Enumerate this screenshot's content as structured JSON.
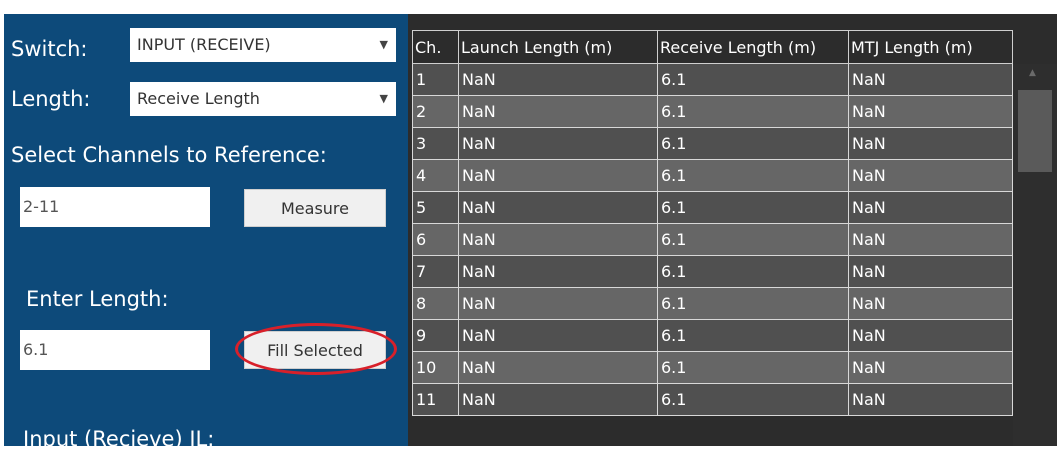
{
  "controls": {
    "switch_label": "Switch:",
    "switch_value": "INPUT (RECEIVE)",
    "length_label": "Length:",
    "length_value": "Receive Length",
    "select_channels_label": "Select Channels to Reference:",
    "channels_value": "2-11",
    "measure_button": "Measure",
    "enter_length_label": "Enter Length:",
    "length_input_value": "6.1",
    "fill_selected_button": "Fill Selected",
    "input_il_label": "Input (Recieve) IL:"
  },
  "table": {
    "columns": [
      "Ch.",
      "Launch Length (m)",
      "Receive Length (m)",
      "MTJ Length (m)"
    ],
    "rows": [
      [
        "1",
        "NaN",
        "6.1",
        "NaN"
      ],
      [
        "2",
        "NaN",
        "6.1",
        "NaN"
      ],
      [
        "3",
        "NaN",
        "6.1",
        "NaN"
      ],
      [
        "4",
        "NaN",
        "6.1",
        "NaN"
      ],
      [
        "5",
        "NaN",
        "6.1",
        "NaN"
      ],
      [
        "6",
        "NaN",
        "6.1",
        "NaN"
      ],
      [
        "7",
        "NaN",
        "6.1",
        "NaN"
      ],
      [
        "8",
        "NaN",
        "6.1",
        "NaN"
      ],
      [
        "9",
        "NaN",
        "6.1",
        "NaN"
      ],
      [
        "10",
        "NaN",
        "6.1",
        "NaN"
      ],
      [
        "11",
        "NaN",
        "6.1",
        "NaN"
      ]
    ]
  },
  "icons": {
    "dropdown": "chevron-down-icon",
    "scroll_up": "scroll-up-arrow-icon"
  },
  "colors": {
    "panel_background": "#0d4a7a",
    "grid_background": "#2c2c2c",
    "row_odd": "#505050",
    "row_even": "#666666",
    "highlight_circle": "#d8202a"
  }
}
